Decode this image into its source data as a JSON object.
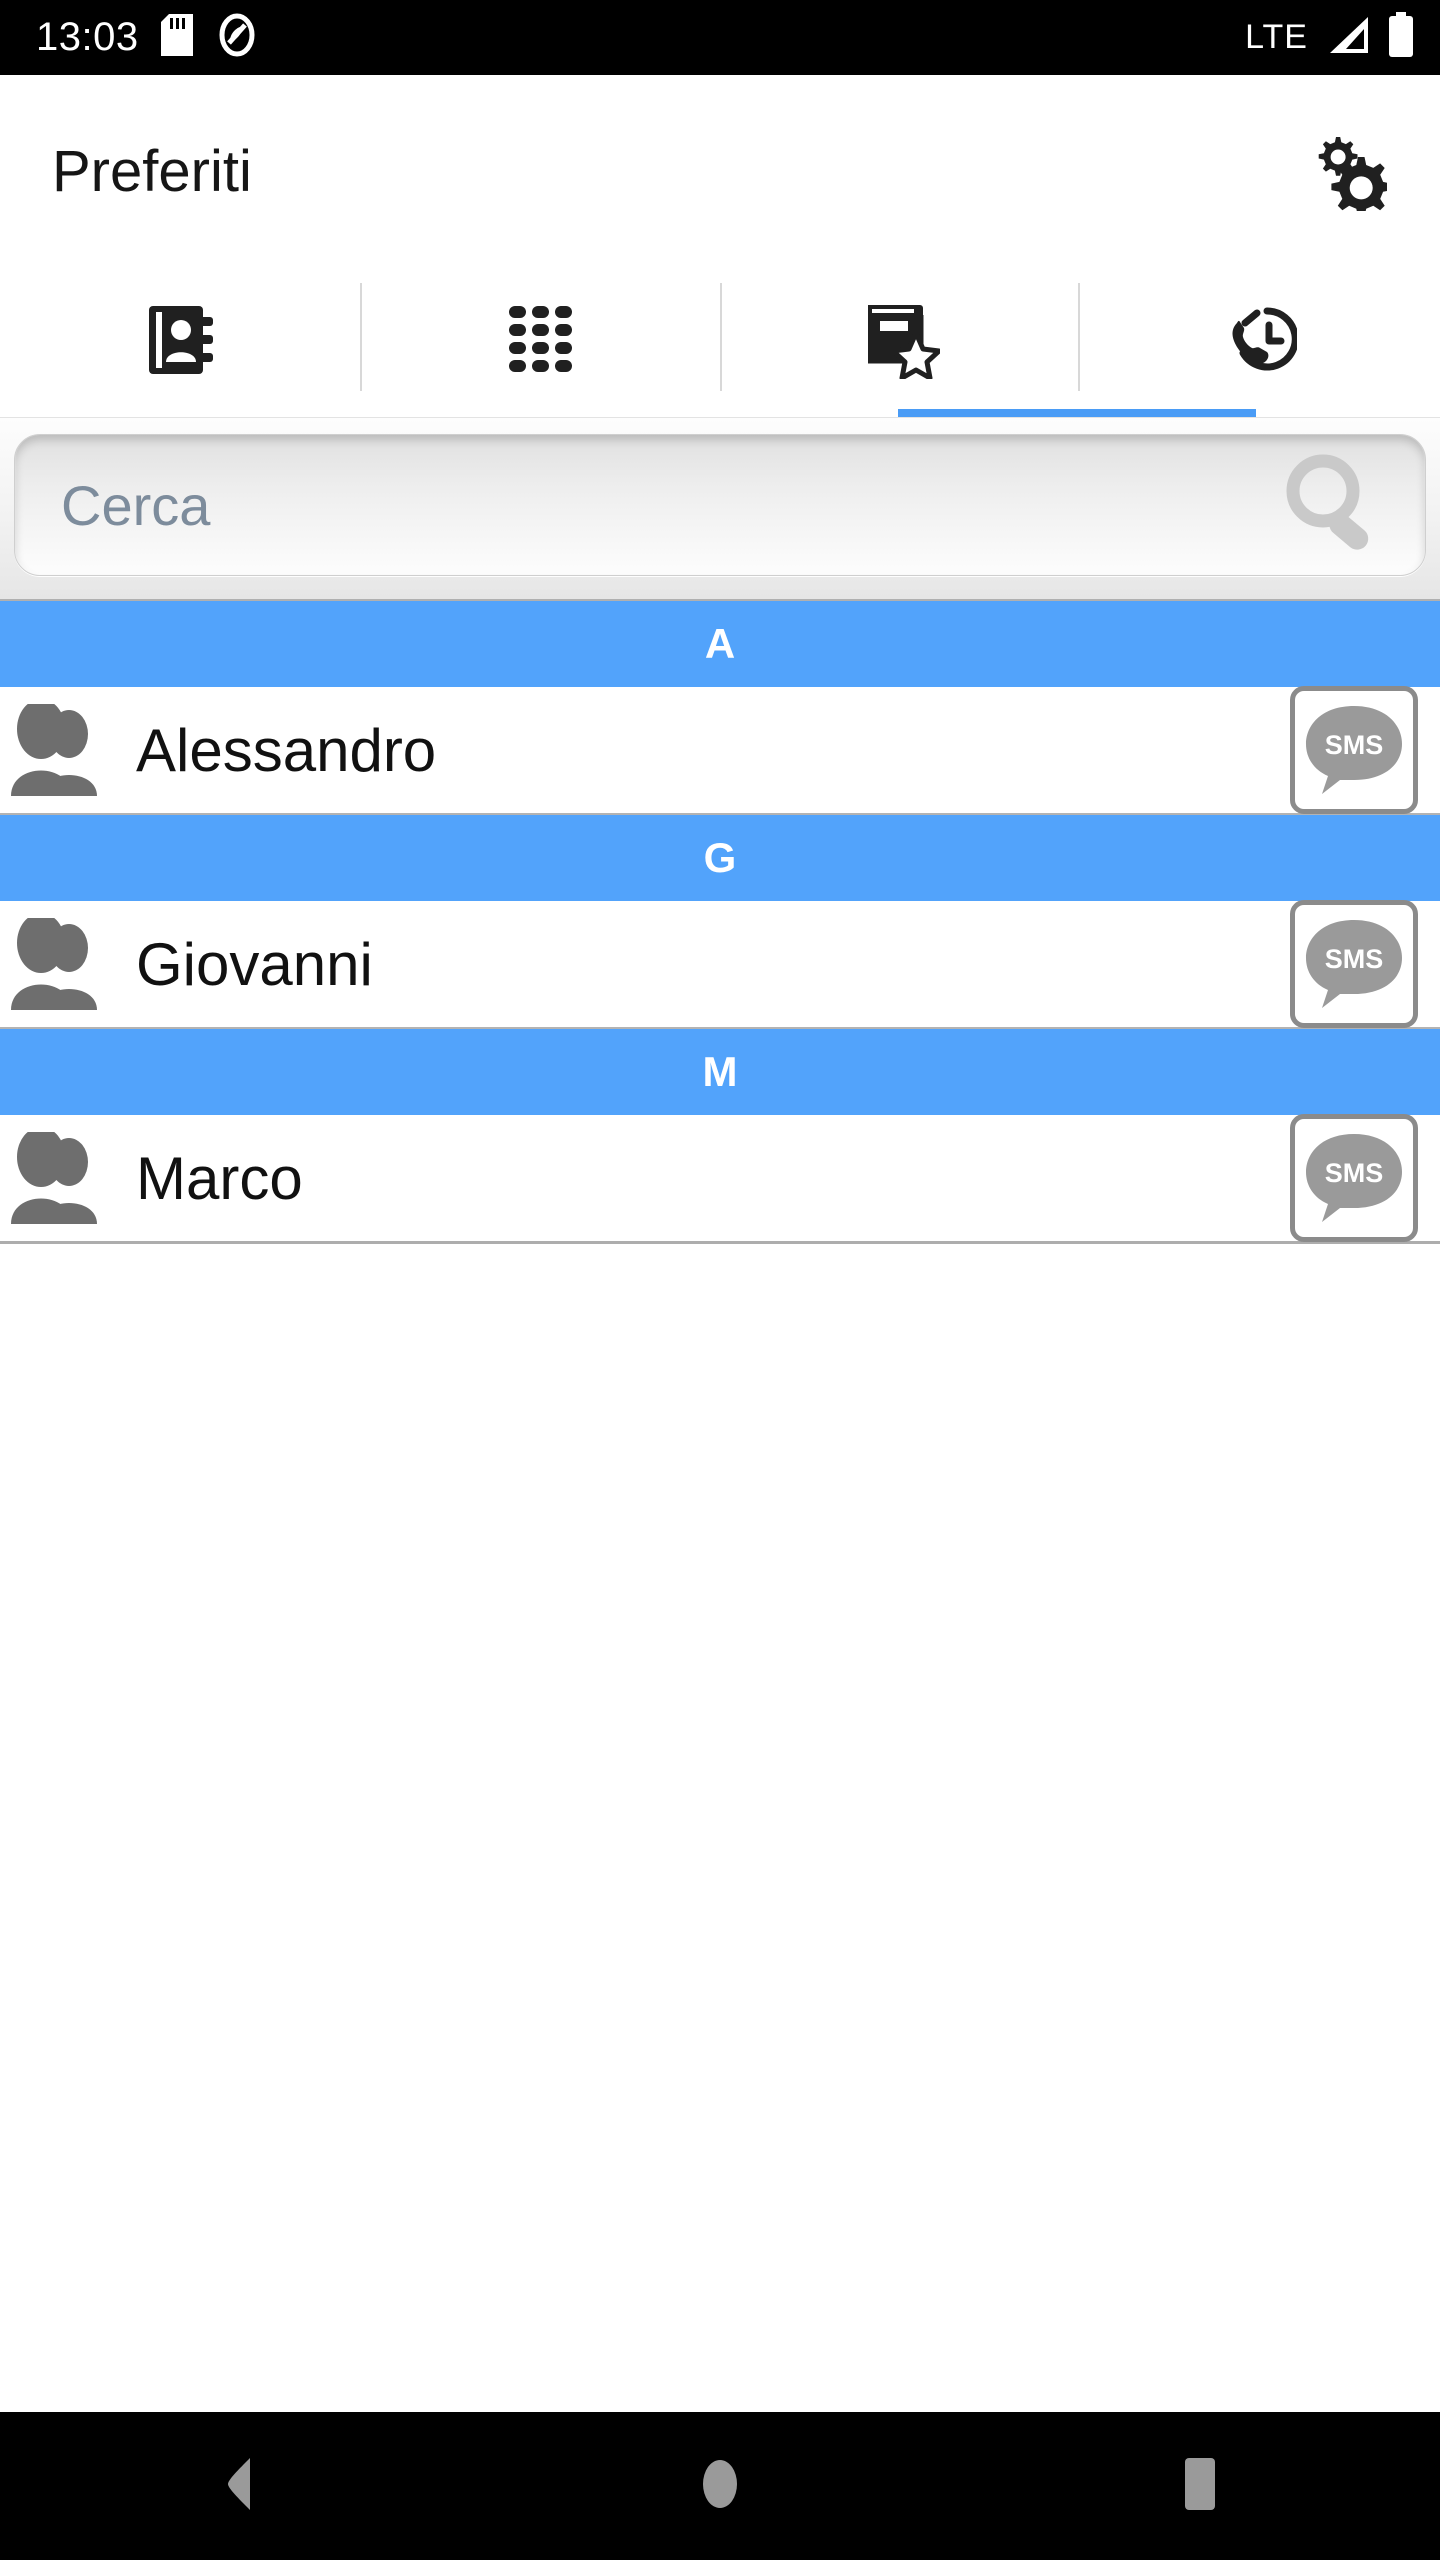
{
  "status_bar": {
    "time": "13:03",
    "icons_left": [
      "sd-card-icon",
      "android-no-sim-icon"
    ],
    "network_label": "LTE",
    "icons_right": [
      "signal-bars-icon",
      "battery-full-icon"
    ]
  },
  "app_bar": {
    "title": "Preferiti",
    "settings_icon": "gears-icon"
  },
  "tabs": [
    {
      "icon": "contacts-book-icon",
      "name": "contacts",
      "active": false
    },
    {
      "icon": "dialpad-icon",
      "name": "dialpad",
      "active": false
    },
    {
      "icon": "favorites-book-star-icon",
      "name": "favorites",
      "active": true
    },
    {
      "icon": "call-history-icon",
      "name": "history",
      "active": false
    }
  ],
  "search": {
    "placeholder": "Cerca",
    "value": "",
    "icon": "search-magnifier-icon"
  },
  "list": {
    "sections": [
      {
        "letter": "A",
        "contacts": [
          {
            "name": "Alessandro",
            "avatar_icon": "two-people-icon",
            "action_label": "SMS",
            "action_icon": "sms-bubble-icon"
          }
        ]
      },
      {
        "letter": "G",
        "contacts": [
          {
            "name": "Giovanni",
            "avatar_icon": "two-people-icon",
            "action_label": "SMS",
            "action_icon": "sms-bubble-icon"
          }
        ]
      },
      {
        "letter": "M",
        "contacts": [
          {
            "name": "Marco",
            "avatar_icon": "two-people-icon",
            "action_label": "SMS",
            "action_icon": "sms-bubble-icon"
          }
        ]
      }
    ]
  },
  "nav_bar": {
    "back": "back-triangle-icon",
    "home": "home-circle-icon",
    "recents": "recents-square-icon"
  },
  "colors": {
    "section_blue": "#52a3fb",
    "tab_active_blue": "#4a9cf6",
    "status_bar_bg": "#000000",
    "avatar_gray": "#6e6e6e",
    "sms_gray": "#8b8b8b",
    "placeholder_gray": "#7d8c9c"
  }
}
